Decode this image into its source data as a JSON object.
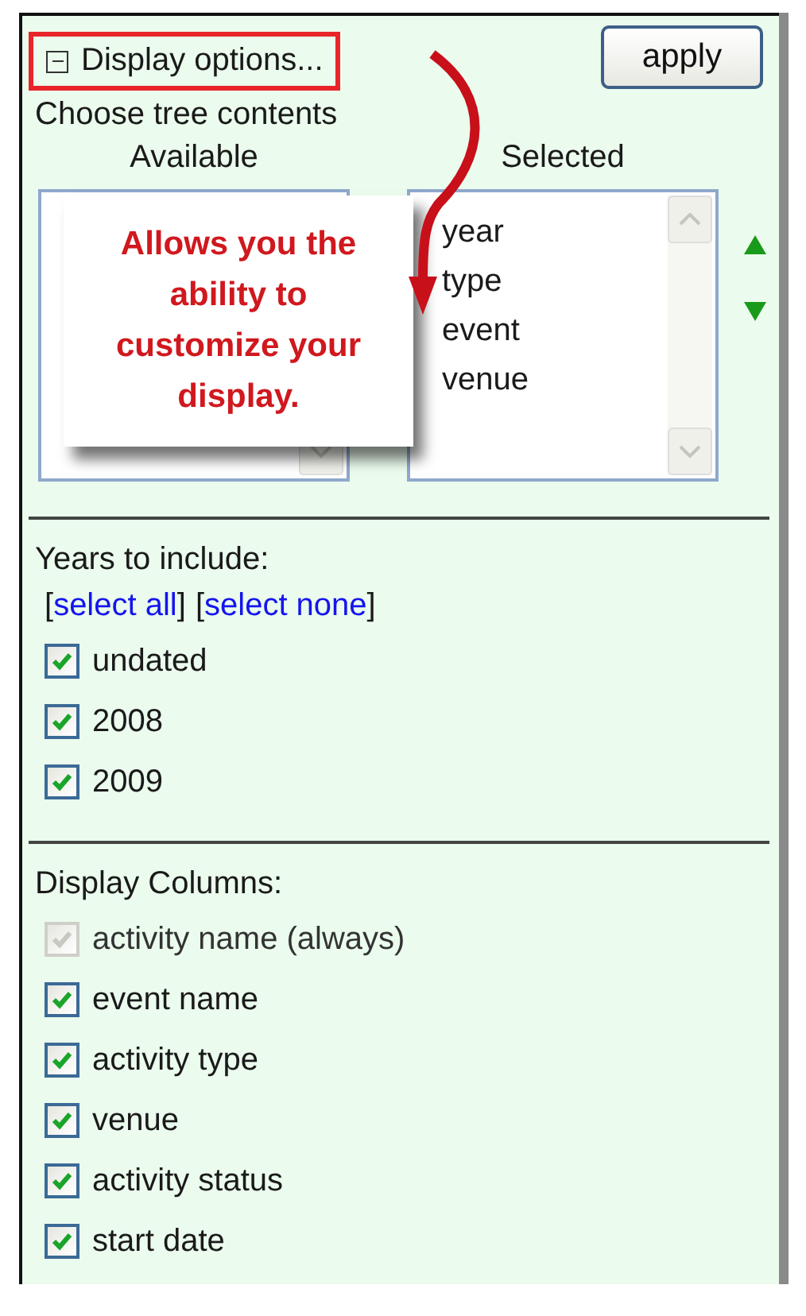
{
  "header": {
    "title": "Display options...",
    "expanded": true,
    "highlighted": true
  },
  "apply_button": "apply",
  "tree": {
    "heading": "Choose tree contents",
    "available": {
      "label": "Available"
    },
    "selected": {
      "label": "Selected",
      "items": [
        "year",
        "type",
        "event",
        "venue"
      ]
    }
  },
  "years": {
    "heading": "Years to include:",
    "links": [
      {
        "open": "[",
        "label": "select all",
        "close": "]"
      },
      {
        "open": "[",
        "label": "select none",
        "close": "]"
      }
    ],
    "items": [
      {
        "label": "undated",
        "checked": true,
        "disabled": false
      },
      {
        "label": "2008",
        "checked": true,
        "disabled": false
      },
      {
        "label": "2009",
        "checked": true,
        "disabled": false
      }
    ]
  },
  "columns": {
    "heading": "Display Columns:",
    "items": [
      {
        "label": "activity name (always)",
        "checked": true,
        "disabled": true
      },
      {
        "label": "event name",
        "checked": true,
        "disabled": false
      },
      {
        "label": "activity type",
        "checked": true,
        "disabled": false
      },
      {
        "label": "venue",
        "checked": true,
        "disabled": false
      },
      {
        "label": "activity status",
        "checked": true,
        "disabled": false
      },
      {
        "label": "start date",
        "checked": true,
        "disabled": false
      }
    ]
  },
  "callout": {
    "text": "Allows you the ability to customize your display."
  }
}
